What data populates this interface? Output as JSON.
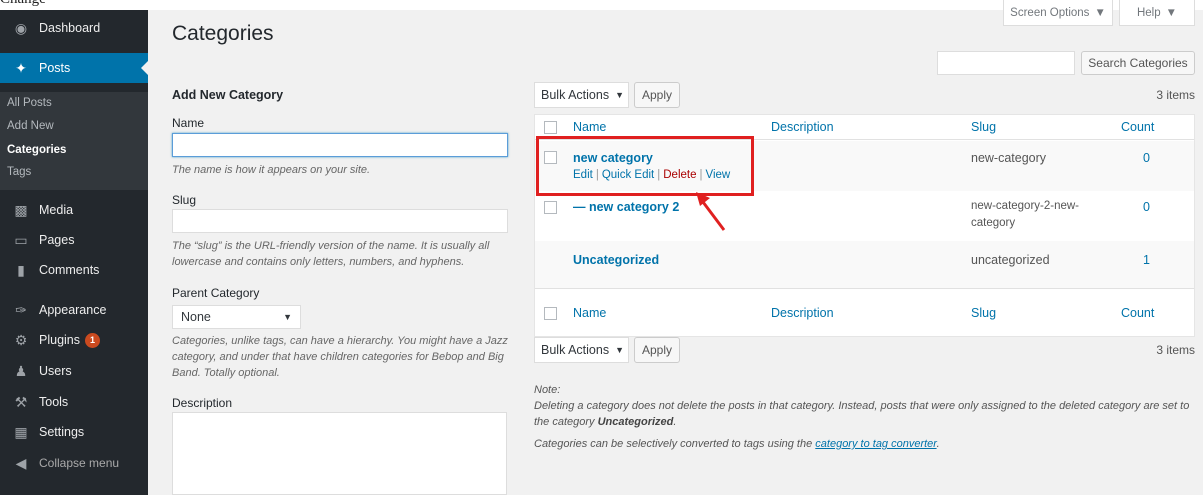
{
  "top_strip_text": "Change",
  "sidebar": {
    "menu": [
      {
        "label": "Dashboard",
        "icon": "dashboard-icon"
      },
      {
        "label": "Posts",
        "icon": "pin-icon",
        "current": true
      },
      {
        "label": "Media",
        "icon": "media-icon"
      },
      {
        "label": "Pages",
        "icon": "pages-icon"
      },
      {
        "label": "Comments",
        "icon": "comments-icon"
      },
      {
        "label": "Appearance",
        "icon": "brush-icon"
      },
      {
        "label": "Plugins",
        "icon": "plugin-icon",
        "badge": "1"
      },
      {
        "label": "Users",
        "icon": "users-icon"
      },
      {
        "label": "Tools",
        "icon": "wrench-icon"
      },
      {
        "label": "Settings",
        "icon": "settings-icon"
      },
      {
        "label": "Collapse menu",
        "icon": "collapse-icon"
      }
    ],
    "submenu": [
      "All Posts",
      "Add New",
      "Categories",
      "Tags"
    ]
  },
  "header": {
    "screen_options": "Screen Options",
    "help": "Help",
    "title": "Categories",
    "search_button": "Search Categories",
    "search_value": ""
  },
  "form": {
    "title": "Add New Category",
    "name_label": "Name",
    "name_value": "",
    "name_desc": "The name is how it appears on your site.",
    "slug_label": "Slug",
    "slug_value": "",
    "slug_desc": "The “slug” is the URL-friendly version of the name. It is usually all lowercase and contains only letters, numbers, and hyphens.",
    "parent_label": "Parent Category",
    "parent_value": "None",
    "parent_desc": "Categories, unlike tags, can have a hierarchy. You might have a Jazz category, and under that have children categories for Bebop and Big Band. Totally optional.",
    "description_label": "Description"
  },
  "table": {
    "bulk_actions": "Bulk Actions",
    "apply": "Apply",
    "items": "3 items",
    "columns": {
      "name": "Name",
      "description": "Description",
      "slug": "Slug",
      "count": "Count"
    },
    "rows": [
      {
        "name": "new category",
        "description": "",
        "slug": "new-category",
        "count": "0",
        "actions": {
          "edit": "Edit",
          "quick_edit": "Quick Edit",
          "delete": "Delete",
          "view": "View"
        }
      },
      {
        "name": "— new category 2",
        "description": "",
        "slug_line1": "new-category-2-new-",
        "slug_line2": "category",
        "count": "0"
      },
      {
        "name": "Uncategorized",
        "description": "",
        "slug": "uncategorized",
        "count": "1"
      }
    ]
  },
  "note": {
    "heading": "Note:",
    "line1": "Deleting a category does not delete the posts in that category. Instead, posts that were only assigned to the deleted category are set to the category ",
    "uncategorized": "Uncategorized",
    "line1_end": ".",
    "line2": "Categories can be selectively converted to tags using the ",
    "link": "category to tag converter",
    "line2_end": "."
  },
  "colors": {
    "accent": "#0073aa",
    "sidebar": "#23282d",
    "highlight": "#e02020",
    "badge": "#ca4a1f"
  }
}
